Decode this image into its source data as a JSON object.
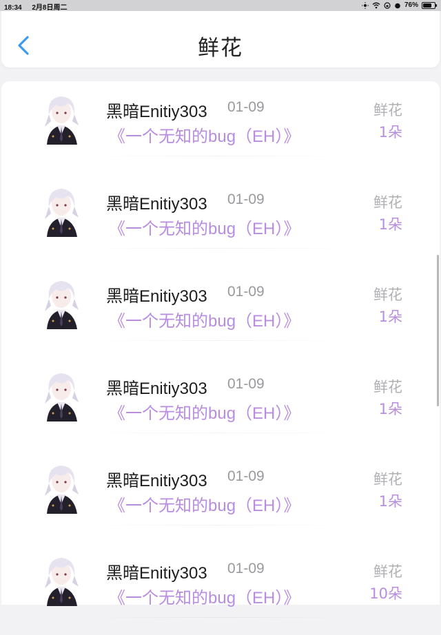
{
  "status_bar": {
    "time": "18:34",
    "date": "2月8日周二",
    "battery": "76%",
    "battery_level": 0.76
  },
  "header": {
    "title": "鲜花",
    "back_icon": "chevron-left-icon",
    "accent_color": "#3a9bf0"
  },
  "records": [
    {
      "user": "黑暗Enitiy303",
      "date": "01-09",
      "book": "《一个无知的bug（EH）》",
      "gift_type": "鲜花",
      "gift_count": "1朵"
    },
    {
      "user": "黑暗Enitiy303",
      "date": "01-09",
      "book": "《一个无知的bug（EH）》",
      "gift_type": "鲜花",
      "gift_count": "1朵"
    },
    {
      "user": "黑暗Enitiy303",
      "date": "01-09",
      "book": "《一个无知的bug（EH）》",
      "gift_type": "鲜花",
      "gift_count": "1朵"
    },
    {
      "user": "黑暗Enitiy303",
      "date": "01-09",
      "book": "《一个无知的bug（EH）》",
      "gift_type": "鲜花",
      "gift_count": "1朵"
    },
    {
      "user": "黑暗Enitiy303",
      "date": "01-09",
      "book": "《一个无知的bug（EH）》",
      "gift_type": "鲜花",
      "gift_count": "1朵"
    },
    {
      "user": "黑暗Enitiy303",
      "date": "01-09",
      "book": "《一个无知的bug（EH）》",
      "gift_type": "鲜花",
      "gift_count": "10朵"
    }
  ],
  "colors": {
    "book_title": "#b88de0",
    "gift_type": "#b0b0b4"
  }
}
